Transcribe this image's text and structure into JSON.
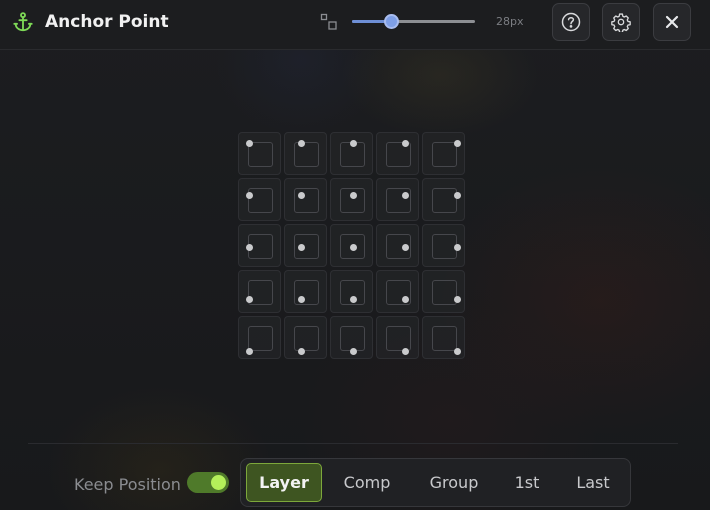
{
  "app": {
    "title": "Anchor Point"
  },
  "header": {
    "size_slider": {
      "value_label": "28px",
      "level": 0.32
    },
    "buttons": [
      "help-icon",
      "gear-icon",
      "close-icon"
    ]
  },
  "grid": {
    "rows": 5,
    "cols": 5,
    "selected": null
  },
  "footer": {
    "keep_position_label": "Keep Position",
    "keep_position_on": true,
    "targets": [
      "Layer",
      "Comp",
      "Group",
      "1st",
      "Last"
    ],
    "active_target": "Layer"
  },
  "colors": {
    "accent_green": "#b4f05a",
    "active_fill": "#3e5521",
    "slider_blue": "#7e9fe6"
  }
}
